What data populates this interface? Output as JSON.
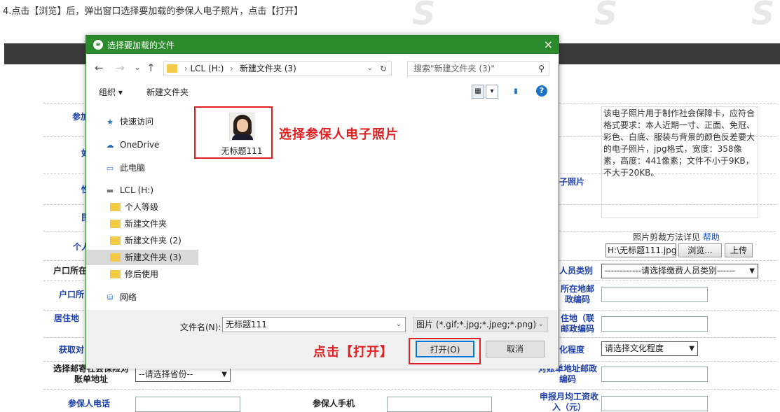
{
  "caption": "4.点击【浏览】后，弹出窗口选择要加载的参保人电子照片，点击【打开】",
  "watermark": "S",
  "background_form": {
    "labels": [
      "参加",
      "如",
      "性",
      "民",
      "个人",
      "户口所在",
      "户口所",
      "居住地",
      "获取对",
      "选择邮寄社会保险对账单地址",
      "参保人电话",
      "参保人手机",
      "子照片",
      "人员类别",
      "所在地邮政编码",
      "住地（联邮政编码",
      "化程度",
      "对账单地址邮政编码",
      "申报月均工资收入（元）"
    ],
    "province_select": "--请选择省份--",
    "category_select": "------------请选择缴费人员类别------",
    "education_select": "请选择文化程度",
    "photo_description": "该电子照片用于制作社会保障卡，应符合格式要求：本人近期一寸、正面、免冠、彩色、白底、服装与背景的颜色反差要大的电子照片，jpg格式，宽度：358像素，高度：441像素；文件不小于9KB，不大于20KB。",
    "photo_crop_text": "照片剪裁方法详见",
    "help_link": "帮助",
    "photo_path": "H:\\无标题111.jpg",
    "browse_button": "浏览...",
    "upload_button": "上传"
  },
  "dialog": {
    "title": "选择要加载的文件",
    "close_icon": "×",
    "nav": {
      "back": "←",
      "forward": "→",
      "dropdown": "⌄",
      "up": "↑"
    },
    "breadcrumb": [
      "LCL (H:)",
      "新建文件夹 (3)"
    ],
    "search_placeholder": "搜索\"新建文件夹 (3)\"",
    "toolbar": {
      "organize": "组织 ▾",
      "new_folder": "新建文件夹",
      "help": "?"
    },
    "nav_items": [
      {
        "label": "快速访问",
        "icon": "star-icon"
      },
      {
        "label": "OneDrive",
        "icon": "cloud-icon"
      },
      {
        "label": "此电脑",
        "icon": "computer-icon"
      },
      {
        "label": "LCL (H:)",
        "icon": "drive-icon"
      },
      {
        "label": "个人等级",
        "icon": "folder-icon"
      },
      {
        "label": "新建文件夹",
        "icon": "folder-icon"
      },
      {
        "label": "新建文件夹 (2)",
        "icon": "folder-icon"
      },
      {
        "label": "新建文件夹 (3)",
        "icon": "folder-icon",
        "selected": true
      },
      {
        "label": "修后使用",
        "icon": "folder-icon"
      },
      {
        "label": "网络",
        "icon": "network-icon"
      }
    ],
    "file": {
      "name": "无标题111"
    },
    "annotation_select": "选择参保人电子照片",
    "annotation_open": "点击【打开】",
    "filename_label": "文件名(N):",
    "filename_value": "无标题111",
    "filter_value": "图片 (*.gif;*.jpg;*.jpeg;*.png)",
    "open_button": "打开(O)",
    "cancel_button": "取消"
  },
  "colors": {
    "titlebar": "#2b8a2b",
    "annotation": "#e02020",
    "label_blue": "#1e40af"
  }
}
